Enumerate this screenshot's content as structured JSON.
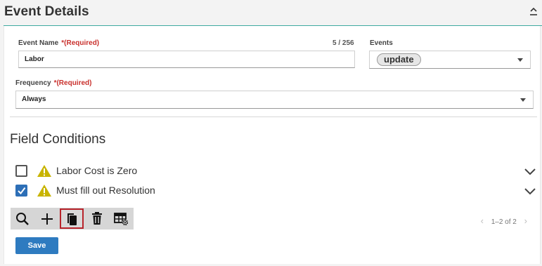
{
  "header": {
    "title": "Event Details"
  },
  "form": {
    "event_name": {
      "label": "Event Name",
      "required": "*(Required)",
      "value": "Labor",
      "counter": "5 / 256"
    },
    "events": {
      "label": "Events",
      "chip": "update"
    },
    "frequency": {
      "label": "Frequency",
      "required": "*(Required)",
      "value": "Always"
    }
  },
  "field_conditions": {
    "title": "Field Conditions",
    "items": [
      {
        "label": "Labor Cost is Zero",
        "checked": false
      },
      {
        "label": "Must fill out Resolution",
        "checked": true
      }
    ]
  },
  "toolbar": {
    "buttons": [
      {
        "name": "search-icon"
      },
      {
        "name": "add-icon"
      },
      {
        "name": "copy-icon",
        "active": true
      },
      {
        "name": "trash-icon"
      },
      {
        "name": "table-settings-icon"
      }
    ]
  },
  "pager": {
    "text": "1–2 of 2"
  },
  "actions": {
    "save_label": "Save"
  },
  "colors": {
    "accent": "#3ea99f",
    "required": "#c9302c",
    "primary": "#2e7bc0",
    "checkbox": "#2d6fb7",
    "active_border": "#b8232b",
    "warning": "#c8b400"
  }
}
